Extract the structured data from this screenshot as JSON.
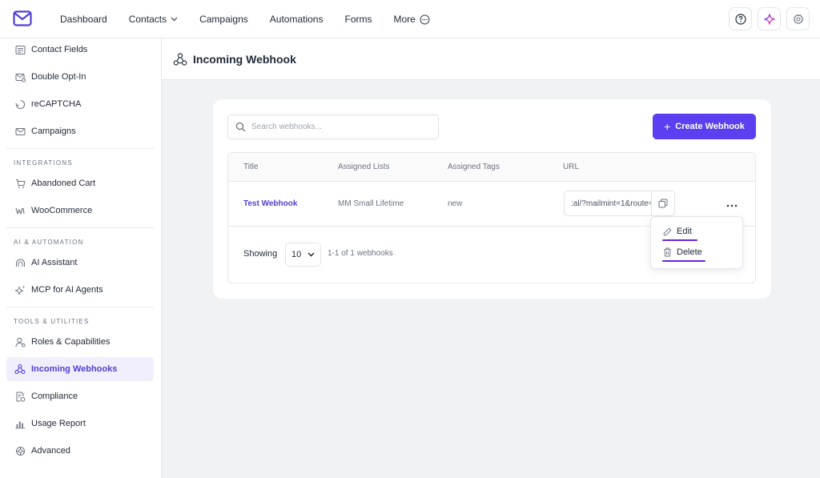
{
  "topnav": {
    "items": [
      {
        "label": "Dashboard"
      },
      {
        "label": "Contacts"
      },
      {
        "label": "Campaigns"
      },
      {
        "label": "Automations"
      },
      {
        "label": "Forms"
      },
      {
        "label": "More"
      }
    ]
  },
  "sidebar": {
    "items_top": [
      {
        "label": "Contact Fields",
        "icon": "contact-fields-icon"
      },
      {
        "label": "Double Opt-In",
        "icon": "double-opt-in-icon"
      },
      {
        "label": "reCAPTCHA",
        "icon": "recaptcha-icon"
      },
      {
        "label": "Campaigns",
        "icon": "campaigns-icon"
      }
    ],
    "sections": [
      {
        "label": "INTEGRATIONS",
        "items": [
          {
            "label": "Abandoned Cart",
            "icon": "cart-icon"
          },
          {
            "label": "WooCommerce",
            "icon": "woocommerce-icon"
          }
        ]
      },
      {
        "label": "AI & AUTOMATION",
        "items": [
          {
            "label": "AI Assistant",
            "icon": "ai-assistant-icon"
          },
          {
            "label": "MCP for AI Agents",
            "icon": "sparkle-icon"
          }
        ]
      },
      {
        "label": "TOOLS & UTILITIES",
        "items": [
          {
            "label": "Roles & Capabilities",
            "icon": "roles-icon"
          },
          {
            "label": "Incoming Webhooks",
            "icon": "webhook-icon",
            "active": true
          },
          {
            "label": "Compliance",
            "icon": "compliance-icon"
          },
          {
            "label": "Usage Report",
            "icon": "chart-icon"
          },
          {
            "label": "Advanced",
            "icon": "advanced-icon"
          }
        ]
      }
    ]
  },
  "page": {
    "title": "Incoming Webhook"
  },
  "search": {
    "placeholder": "Search webhooks..."
  },
  "create_button": {
    "label": "Create Webhook"
  },
  "table": {
    "columns": [
      "Title",
      "Assigned Lists",
      "Assigned Tags",
      "URL"
    ],
    "rows": [
      {
        "title": "Test Webhook",
        "lists": "MM Small Lifetime",
        "tags": "new",
        "url": ":al/?mailmint=1&route="
      }
    ]
  },
  "pagination": {
    "showing_label": "Showing",
    "per_page": "10",
    "range": "1-1 of 1 webhooks"
  },
  "row_menu": {
    "edit": "Edit",
    "delete": "Delete"
  },
  "colors": {
    "accent": "#5c3ff0",
    "underline": "#6425e0",
    "active_bg": "#f1effd"
  }
}
